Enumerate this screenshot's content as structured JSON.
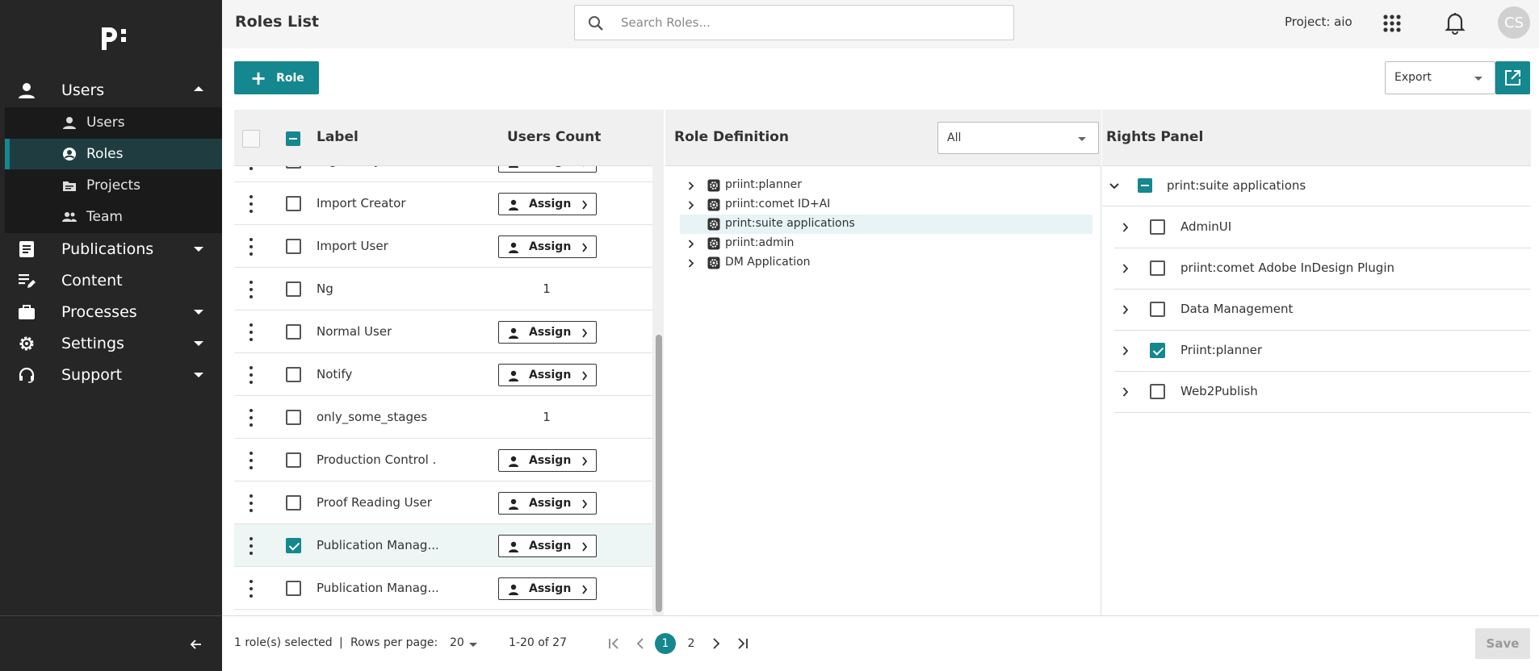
{
  "sidebar": {
    "logo_text": "p:",
    "nav": [
      {
        "label": "Users",
        "icon": "user-icon",
        "expanded": true
      },
      {
        "label": "Publications",
        "icon": "document-icon",
        "expanded": false
      },
      {
        "label": "Content",
        "icon": "edit-list-icon",
        "expanded": null
      },
      {
        "label": "Processes",
        "icon": "briefcase-icon",
        "expanded": false
      },
      {
        "label": "Settings",
        "icon": "gear-icon",
        "expanded": false
      },
      {
        "label": "Support",
        "icon": "headset-icon",
        "expanded": false
      }
    ],
    "sub_items": [
      {
        "label": "Users",
        "icon": "person-icon",
        "active": false
      },
      {
        "label": "Roles",
        "icon": "account-circle-icon",
        "active": true
      },
      {
        "label": "Projects",
        "icon": "folder-icon",
        "active": false
      },
      {
        "label": "Team",
        "icon": "group-icon",
        "active": false
      }
    ]
  },
  "header": {
    "title": "Roles List",
    "search_placeholder": "Search Roles...",
    "project": "Project: aio",
    "avatar_initials": "CS"
  },
  "toolbar": {
    "add_role_label": "Role",
    "export_label": "Export"
  },
  "roles_table": {
    "columns": {
      "label": "Label",
      "users_count": "Users Count"
    },
    "assign_label": "Assign",
    "rows": [
      {
        "label": "Digital Layout Wrok...",
        "count": null,
        "checked": false
      },
      {
        "label": "Import Creator",
        "count": null,
        "checked": false
      },
      {
        "label": "Import User",
        "count": null,
        "checked": false
      },
      {
        "label": "Ng",
        "count": "1",
        "checked": false
      },
      {
        "label": "Normal User",
        "count": null,
        "checked": false
      },
      {
        "label": "Notify",
        "count": null,
        "checked": false
      },
      {
        "label": "only_some_stages",
        "count": "1",
        "checked": false
      },
      {
        "label": "Production Control ...",
        "count": null,
        "checked": false
      },
      {
        "label": "Proof Reading User",
        "count": null,
        "checked": false
      },
      {
        "label": "Publication Manag...",
        "count": null,
        "checked": true
      },
      {
        "label": "Publication Manag...",
        "count": null,
        "checked": false
      }
    ]
  },
  "role_definition": {
    "title": "Role Definition",
    "filter_value": "All",
    "tree": [
      {
        "label": "priint:planner",
        "expandable": true,
        "active": false
      },
      {
        "label": "priint:comet ID+AI",
        "expandable": true,
        "active": false
      },
      {
        "label": "print:suite applications",
        "expandable": false,
        "active": true
      },
      {
        "label": "priint:admin",
        "expandable": true,
        "active": false
      },
      {
        "label": "DM Application",
        "expandable": true,
        "active": false
      }
    ]
  },
  "rights_panel": {
    "title": "Rights Panel",
    "root_label": "print:suite applications",
    "items": [
      {
        "label": "AdminUI",
        "checked": false
      },
      {
        "label": "priint:comet Adobe InDesign Plugin",
        "checked": false
      },
      {
        "label": "Data Management",
        "checked": false
      },
      {
        "label": "Priint:planner",
        "checked": true
      },
      {
        "label": "Web2Publish",
        "checked": false
      }
    ]
  },
  "footer": {
    "selected_text": "1 role(s) selected",
    "separator": "|",
    "rows_per_page_label": "Rows per page:",
    "rows_per_page_value": "20",
    "range_text": "1-20 of 27",
    "pages": [
      "1",
      "2"
    ],
    "current_page": "1",
    "save_label": "Save"
  },
  "colors": {
    "accent": "#14878f",
    "sidebar_bg": "#262626",
    "active_row_bg": "#edf5f5"
  }
}
